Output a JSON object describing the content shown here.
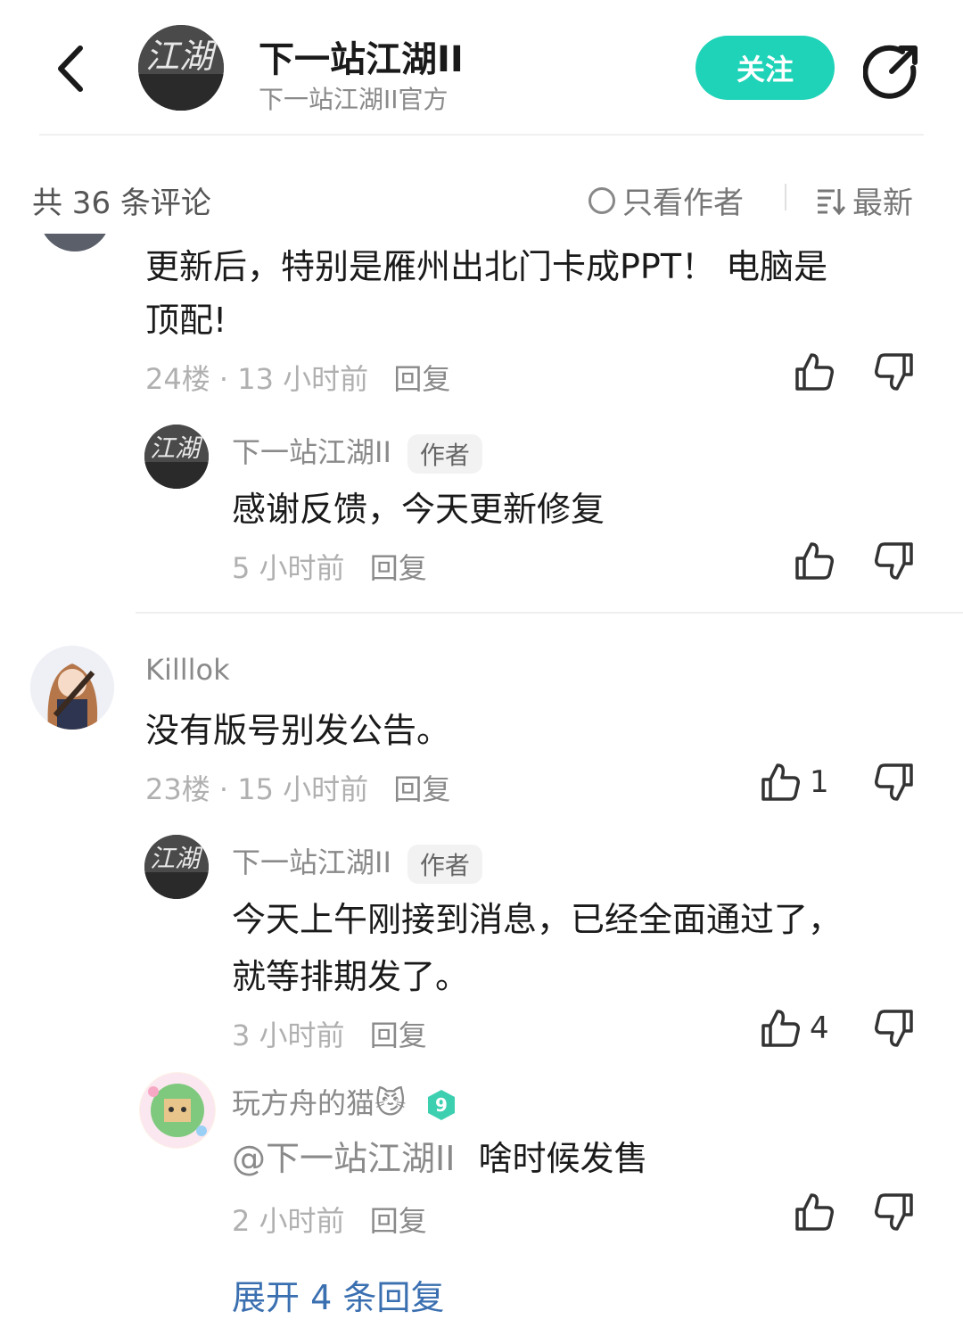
{
  "header": {
    "name": "下一站江湖II",
    "subtitle": "下一站江湖II官方",
    "follow_label": "关注",
    "avatar_text": "江湖"
  },
  "toolbar": {
    "count_label": "共 36 条评论",
    "author_only_label": "只看作者",
    "sort_label": "最新"
  },
  "comments": [
    {
      "text_line1": "更新后，特别是雁州出北门卡成PPT！ 电脑是",
      "text_line2": "顶配!",
      "floor": "24楼",
      "time": "13 小时前",
      "reply_label": "回复",
      "reply": {
        "user": "下一站江湖II",
        "badge": "作者",
        "text": "感谢反馈，今天更新修复",
        "time": "5 小时前",
        "reply_label": "回复"
      }
    },
    {
      "user": "Killlok",
      "text": "没有版号别发公告。",
      "floor": "23楼",
      "time": "15 小时前",
      "reply_label": "回复",
      "likes": "1",
      "replies": [
        {
          "user": "下一站江湖II",
          "badge": "作者",
          "text_line1": "今天上午刚接到消息，已经全面通过了，",
          "text_line2": "就等排期发了。",
          "time": "3 小时前",
          "reply_label": "回复",
          "likes": "4"
        },
        {
          "user": "玩方舟的猫",
          "emoji": "😼",
          "level": "9",
          "text_mention": "@下一站江湖II",
          "text": "啥时候发售",
          "time": "2 小时前",
          "reply_label": "回复"
        }
      ],
      "expand_label": "展开 4 条回复"
    }
  ],
  "colors": {
    "accent": "#1fd3b8",
    "link": "#3a6fb0",
    "muted": "#b0b0b0"
  }
}
